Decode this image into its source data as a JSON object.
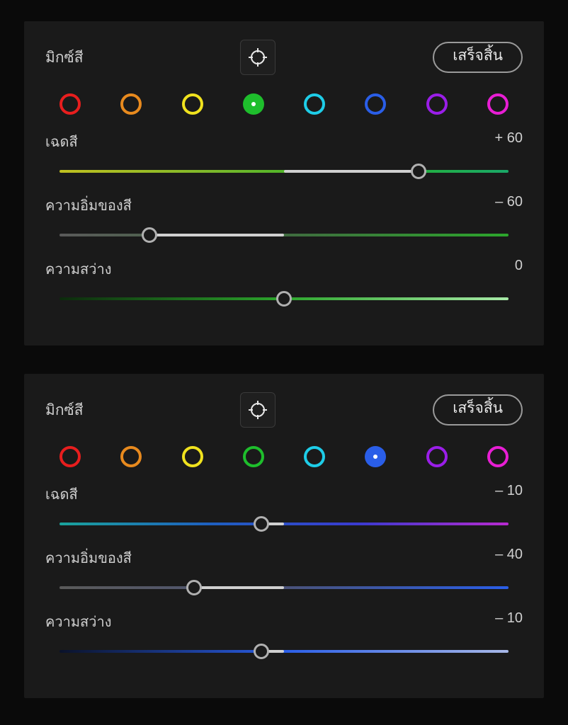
{
  "panels": [
    {
      "title": "มิกซ์สี",
      "done_label": "เสร็จสิ้น",
      "selected_index": 3,
      "swatches": [
        {
          "color": "#e81e1e"
        },
        {
          "color": "#e88a1e"
        },
        {
          "color": "#f0e21e"
        },
        {
          "color": "#1ebe2c"
        },
        {
          "color": "#1ecde8"
        },
        {
          "color": "#2a5ee8"
        },
        {
          "color": "#9a1ee8"
        },
        {
          "color": "#e81ed4"
        }
      ],
      "sliders": [
        {
          "label": "เฉดสี",
          "value_text": "+ 60",
          "value": 60,
          "min": -100,
          "max": 100,
          "gradient": "linear-gradient(90deg,#c0c020,#7db82a,#28b428,#1aa868)"
        },
        {
          "label": "ความอิ่มของสี",
          "value_text": "– 60",
          "value": -60,
          "min": -100,
          "max": 100,
          "gradient": "linear-gradient(90deg,#5a5a5a,#3f6b3f,#2ca62c)"
        },
        {
          "label": "ความสว่าง",
          "value_text": "0",
          "value": 0,
          "min": -100,
          "max": 100,
          "gradient": "linear-gradient(90deg,#0c2a0c,#2ca62c,#a8eaa8)"
        }
      ]
    },
    {
      "title": "มิกซ์สี",
      "done_label": "เสร็จสิ้น",
      "selected_index": 5,
      "swatches": [
        {
          "color": "#e81e1e"
        },
        {
          "color": "#e88a1e"
        },
        {
          "color": "#f0e21e"
        },
        {
          "color": "#1ebe2c"
        },
        {
          "color": "#1ecde8"
        },
        {
          "color": "#2a5ee8"
        },
        {
          "color": "#9a1ee8"
        },
        {
          "color": "#e81ed4"
        }
      ],
      "sliders": [
        {
          "label": "เฉดสี",
          "value_text": "– 10",
          "value": -10,
          "min": -100,
          "max": 100,
          "gradient": "linear-gradient(90deg,#1aa39c,#1e60c0,#3a3ad0,#b82ad0)"
        },
        {
          "label": "ความอิ่มของสี",
          "value_text": "– 40",
          "value": -40,
          "min": -100,
          "max": 100,
          "gradient": "linear-gradient(90deg,#5a5a5a,#4a5278,#2a5ee8)"
        },
        {
          "label": "ความสว่าง",
          "value_text": "– 10",
          "value": -10,
          "min": -100,
          "max": 100,
          "gradient": "linear-gradient(90deg,#0a122a,#2a5ee8,#a8b8e8)"
        }
      ]
    }
  ]
}
